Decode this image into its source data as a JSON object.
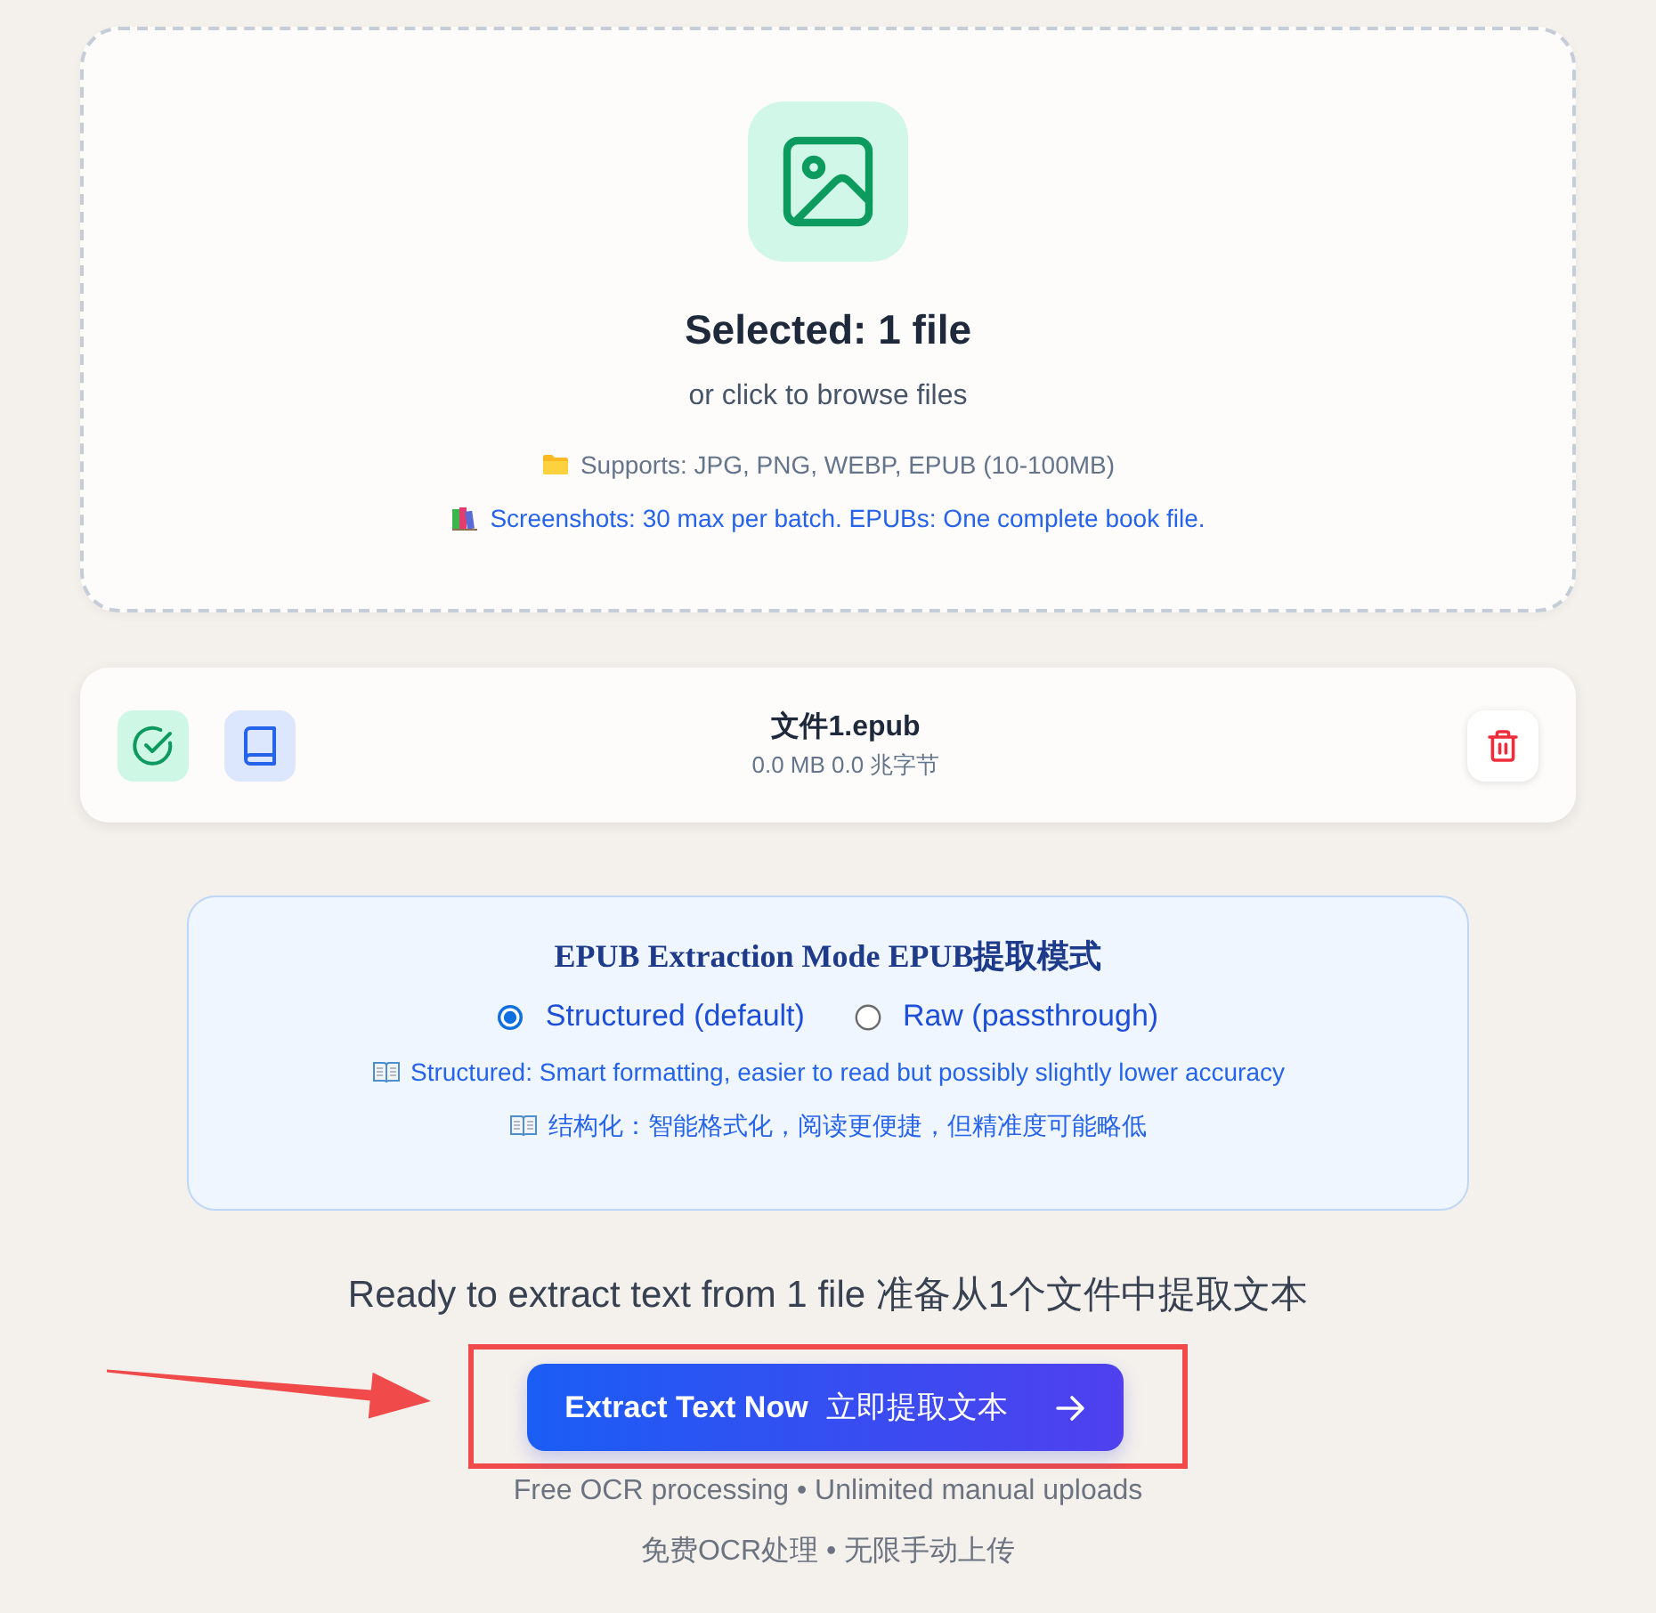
{
  "upload_zone": {
    "title": "Selected: 1 file",
    "subtitle": "or click to browse files",
    "notes": [
      {
        "kind": "support",
        "text": "Supports: JPG, PNG, WEBP, EPUB (10-100MB)"
      },
      {
        "kind": "limit",
        "text": "Screenshots: 30 max per batch. EPUBs: One complete book file."
      }
    ]
  },
  "file": {
    "name": "文件1.epub",
    "details": "0.0 MB 0.0 兆字节"
  },
  "mode": {
    "title": "EPUB Extraction Mode EPUB提取模式",
    "options": [
      {
        "label": "Structured (default)",
        "selected": true
      },
      {
        "label": "Raw (passthrough)",
        "selected": false
      }
    ],
    "descriptions": [
      "Structured: Smart formatting, easier to read but possibly slightly lower accuracy",
      "结构化：智能格式化，阅读更便捷，但精准度可能略低"
    ]
  },
  "ready_text": "Ready to extract text from 1 file 准备从1个文件中提取文本",
  "extract_button": {
    "label": "Extract Text Now",
    "label_secondary": "立即提取文本"
  },
  "footnotes": [
    "Free OCR processing • Unlimited manual uploads",
    "免费OCR处理 • 无限手动上传"
  ]
}
